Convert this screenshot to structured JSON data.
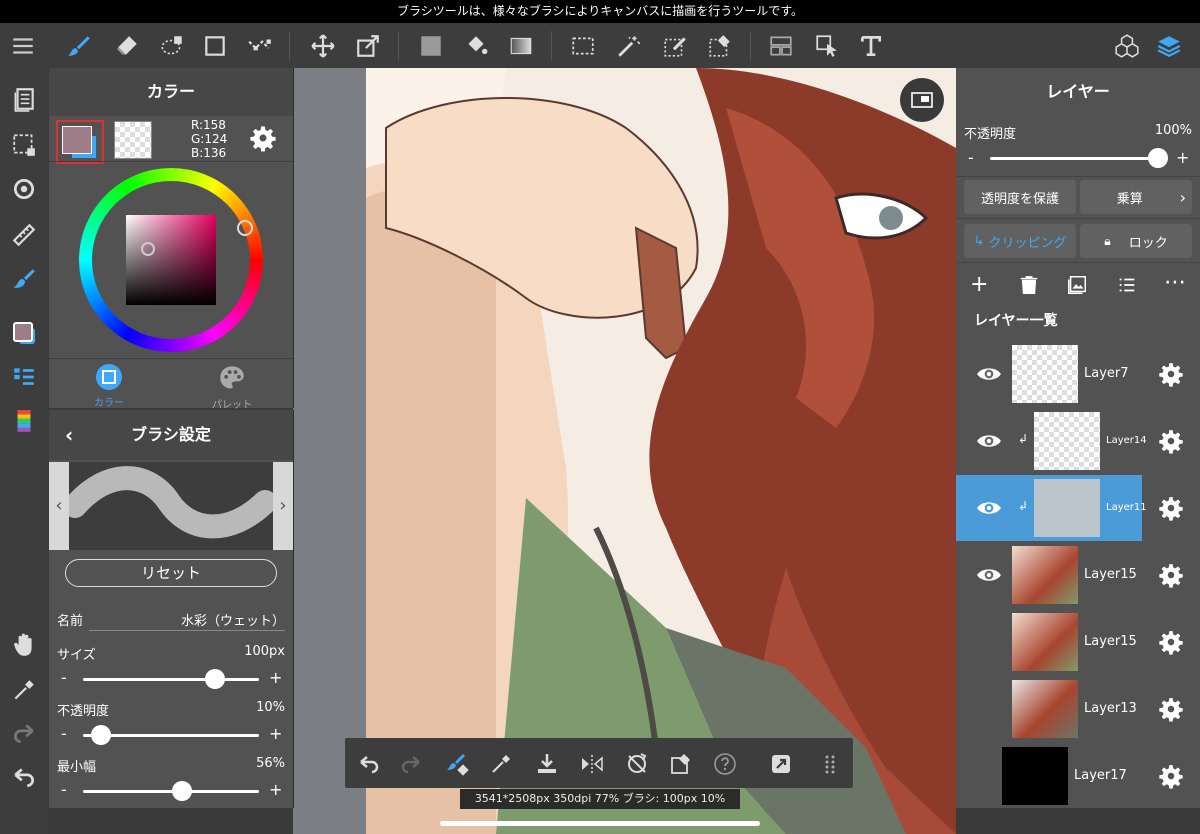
{
  "status": {
    "tooltip": "ブラシツールは、様々なブラシによりキャンバスに描画を行うツールです。"
  },
  "color_panel": {
    "title": "カラー",
    "rgb_r": "R:158",
    "rgb_g": "G:124",
    "rgb_b": "B:136",
    "main_color": "#9e7c88",
    "sub_color": "#3fa9f5",
    "tab_color": "カラー",
    "tab_palette": "パレット"
  },
  "brush_panel": {
    "title": "ブラシ設定",
    "reset": "リセット",
    "name_label": "名前",
    "name_value": "水彩（ウェット）",
    "size_label": "サイズ",
    "size_value": "100px",
    "size_level": 0.75,
    "opacity_label": "不透明度",
    "opacity_value": "10%",
    "opacity_level": 0.1,
    "minwidth_label": "最小幅",
    "minwidth_value": "56%",
    "minwidth_level": 0.56
  },
  "layer_panel": {
    "title": "レイヤー",
    "opacity_label": "不透明度",
    "opacity_value": "100%",
    "protect_alpha": "透明度を保護",
    "blend_mode": "乗算",
    "clipping": "クリッピング",
    "lock": "ロック",
    "list_label": "レイヤー一覧",
    "layers": [
      {
        "name": "Layer7"
      },
      {
        "name": "Layer14"
      },
      {
        "name": "Layer11"
      },
      {
        "name": "Layer15"
      },
      {
        "name": "Layer15"
      },
      {
        "name": "Layer13"
      },
      {
        "name": "Layer17"
      }
    ]
  },
  "info": {
    "text": "3541*2508px 350dpi 77% ブラシ: 100px 10%"
  },
  "colors": {
    "accent": "#3fa9f5",
    "selected_layer": "#4a9bd8"
  }
}
